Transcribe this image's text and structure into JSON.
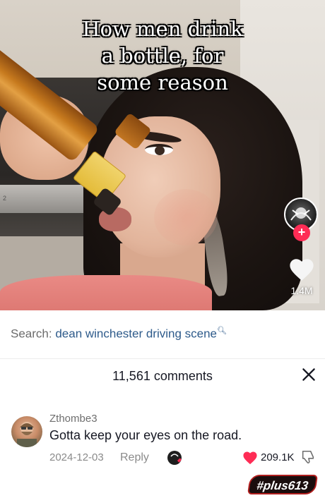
{
  "video": {
    "caption": [
      "How men drink",
      "a bottle, for",
      "some reason"
    ],
    "likes": "1.4M",
    "microwave_label": "2"
  },
  "search": {
    "prefix": "Search:",
    "query": "dean winchester driving scene"
  },
  "comments": {
    "header": "11,561 comments",
    "items": [
      {
        "username": "Zthombe3",
        "text": "Gotta keep your eyes on the road.",
        "date": "2024-12-03",
        "reply_label": "Reply",
        "likes": "209.1K"
      }
    ]
  },
  "watermark": "#plus613",
  "colors": {
    "accent_red": "#fe2c55",
    "search_link": "#2d5a8a"
  },
  "icons": [
    "follow-plus-icon",
    "heart-icon",
    "search-icon",
    "close-icon",
    "creator-liked-icon",
    "dislike-icon"
  ]
}
